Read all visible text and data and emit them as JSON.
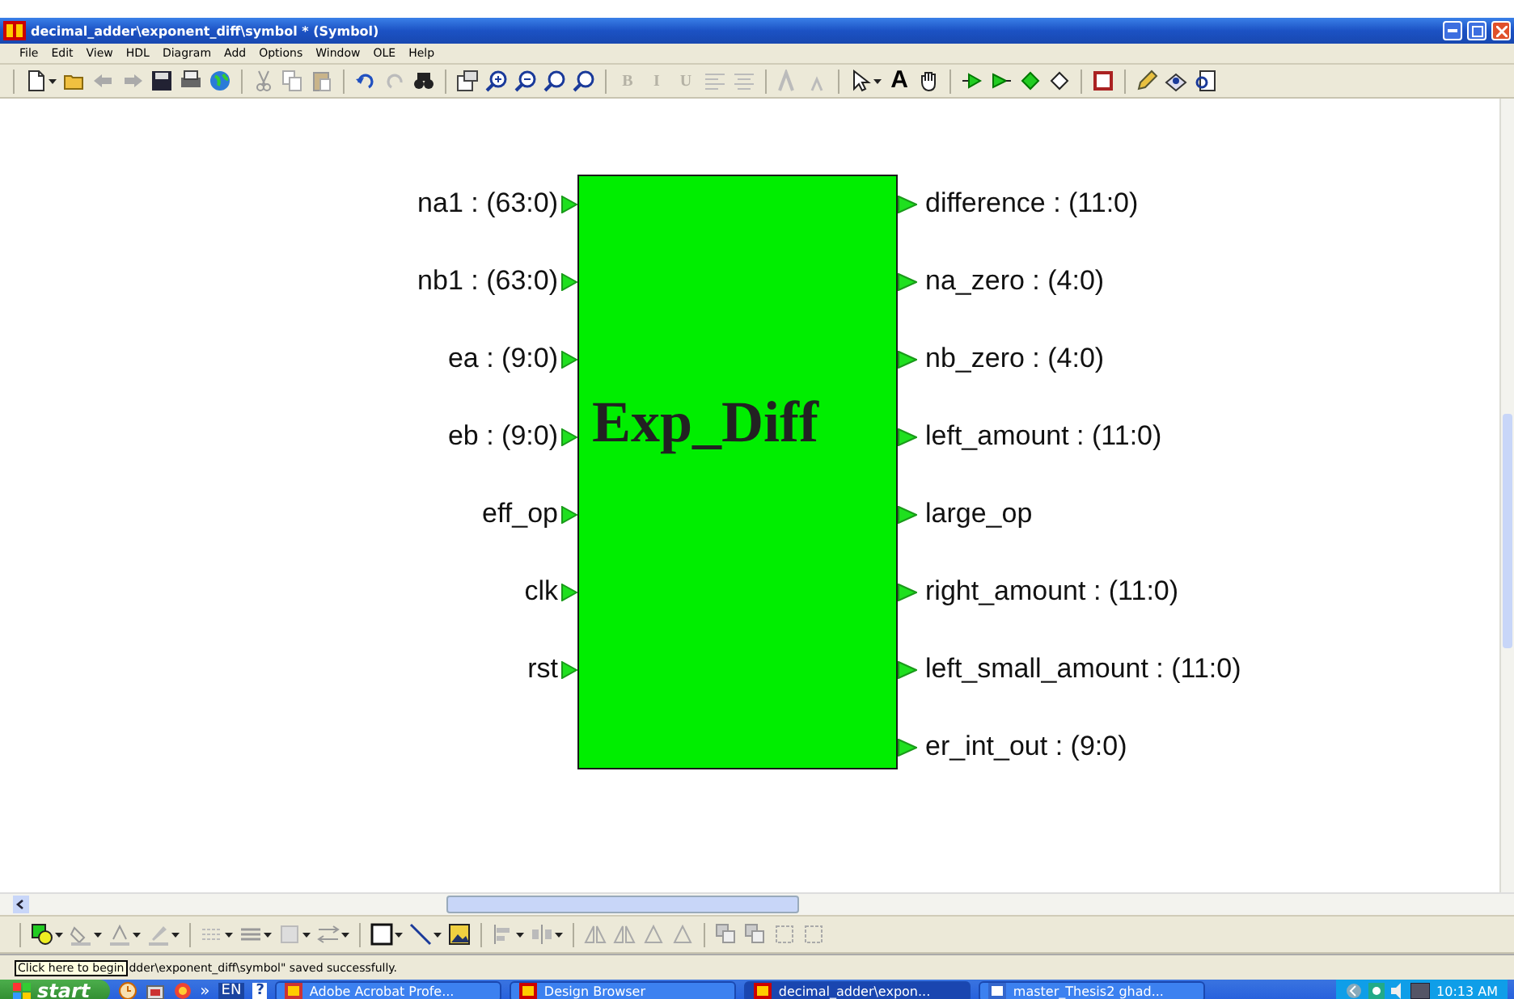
{
  "window": {
    "title": "decimal_adder\\exponent_diff\\symbol * (Symbol)"
  },
  "menu": [
    "File",
    "Edit",
    "View",
    "HDL",
    "Diagram",
    "Add",
    "Options",
    "Window",
    "OLE",
    "Help"
  ],
  "toolbar_glyphs": [
    {
      "label": "B",
      "disabled": true
    },
    {
      "label": "I",
      "disabled": true
    },
    {
      "label": "U",
      "disabled": true
    },
    {
      "label": "A",
      "disabled": false
    }
  ],
  "symbol": {
    "name": "Exp_Diff",
    "inputs": [
      {
        "label": "na1 : (63:0)"
      },
      {
        "label": "nb1 : (63:0)"
      },
      {
        "label": "ea : (9:0)"
      },
      {
        "label": "eb : (9:0)"
      },
      {
        "label": "eff_op"
      },
      {
        "label": "clk"
      },
      {
        "label": "rst"
      }
    ],
    "outputs": [
      {
        "label": "difference : (11:0)"
      },
      {
        "label": "na_zero : (4:0)"
      },
      {
        "label": "nb_zero : (4:0)"
      },
      {
        "label": "left_amount : (11:0)"
      },
      {
        "label": "large_op"
      },
      {
        "label": "right_amount : (11:0)"
      },
      {
        "label": "left_small_amount : (11:0)"
      },
      {
        "label": "er_int_out : (9:0)"
      }
    ]
  },
  "status_bar": {
    "message": "dder\\exponent_diff\\symbol\" saved successfully.",
    "tooltip": "Click here to begin"
  },
  "taskbar": {
    "start": "start",
    "overflow": "»",
    "language": "EN",
    "help": "?",
    "tasks": [
      {
        "label": "Adobe Acrobat Profe...",
        "selected": false
      },
      {
        "label": "Design Browser",
        "selected": false
      },
      {
        "label": "decimal_adder\\expon...",
        "selected": true
      },
      {
        "label": "master_Thesis2 ghad...",
        "selected": false
      }
    ],
    "clock": "10:13 AM"
  }
}
